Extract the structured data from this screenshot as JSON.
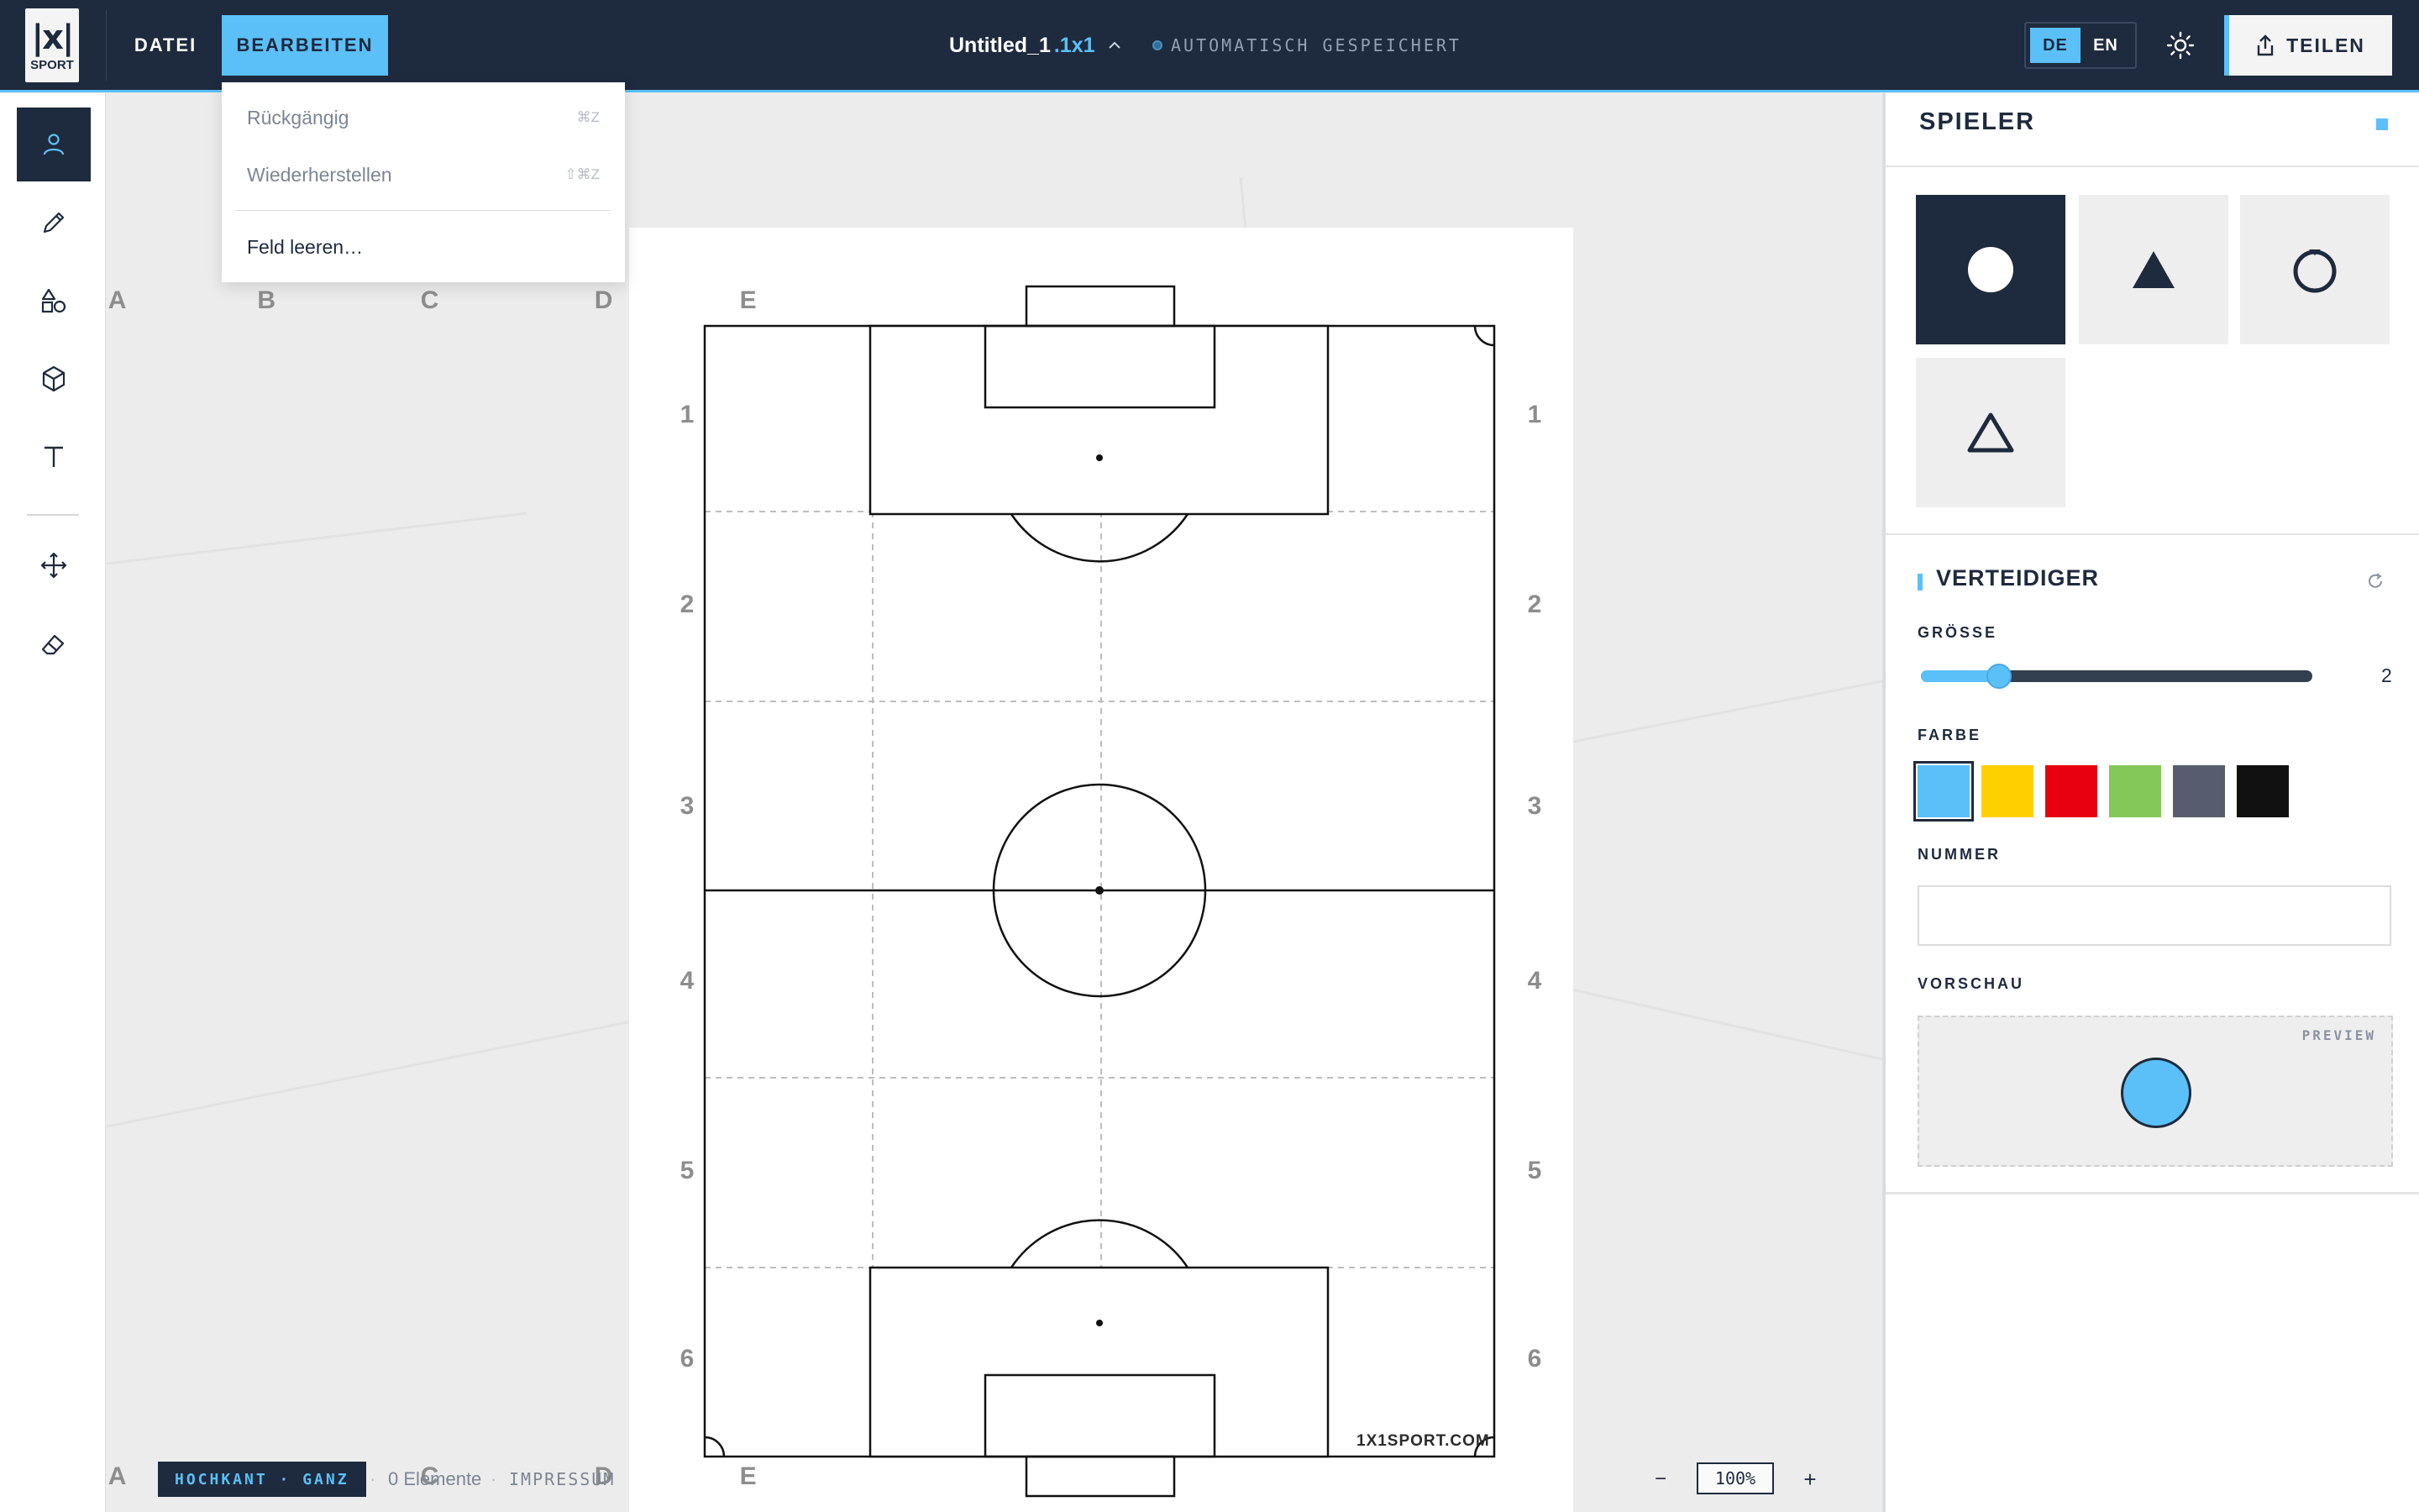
{
  "header": {
    "logo_mark": "|x|",
    "logo_word": "SPORT",
    "menu": {
      "file_label": "DATEI",
      "edit_label": "BEARBEITEN"
    },
    "doc_name": "Untitled_1",
    "doc_ext": ".1x1",
    "save_status": "AUTOMATISCH GESPEICHERT",
    "lang": {
      "de": "DE",
      "en": "EN",
      "active": "DE"
    },
    "theme_icon": "sun-icon",
    "share_label": "TEILEN"
  },
  "edit_menu": {
    "undo": {
      "label": "Rückgängig",
      "shortcut": "⌘Z"
    },
    "redo": {
      "label": "Wiederherstellen",
      "shortcut": "⇧⌘Z"
    },
    "clear": {
      "label": "Feld leeren…"
    }
  },
  "toolbar": {
    "tools": [
      "player-icon",
      "pencil-icon",
      "shapes-icon",
      "cube-icon",
      "text-icon",
      "move-icon",
      "eraser-icon"
    ],
    "active": "player-icon"
  },
  "pitch": {
    "columns": [
      "A",
      "B",
      "C",
      "D",
      "E"
    ],
    "rows": [
      "1",
      "2",
      "3",
      "4",
      "5",
      "6"
    ],
    "watermark": "1X1SPORT.COM"
  },
  "status": {
    "view_mode": "HOCHKANT · GANZ",
    "separator": "·",
    "element_count": "0 Elemente",
    "imprint": "IMPRESSUM",
    "zoom_minus": "−",
    "zoom_value": "100%",
    "zoom_plus": "+"
  },
  "panel": {
    "title": "SPIELER",
    "shapes": [
      "filled-circle-icon",
      "filled-triangle-icon",
      "ring-icon",
      "outline-triangle-icon"
    ],
    "selected_shape": "filled-circle-icon",
    "section_title": "VERTEIDIGER",
    "size_label": "GRÖSSE",
    "size_value": "2",
    "size_fraction": 0.2,
    "color_label": "FARBE",
    "colors": [
      "#5bc0f8",
      "#ffd000",
      "#e8000f",
      "#85c85a",
      "#575d6e",
      "#111111"
    ],
    "selected_color": "#5bc0f8",
    "number_label": "NUMMER",
    "number_value": "",
    "preview_label": "VORSCHAU",
    "preview_tag": "PREVIEW"
  },
  "colors": {
    "navy": "#1e2a3d",
    "accent": "#5bc0f8"
  }
}
